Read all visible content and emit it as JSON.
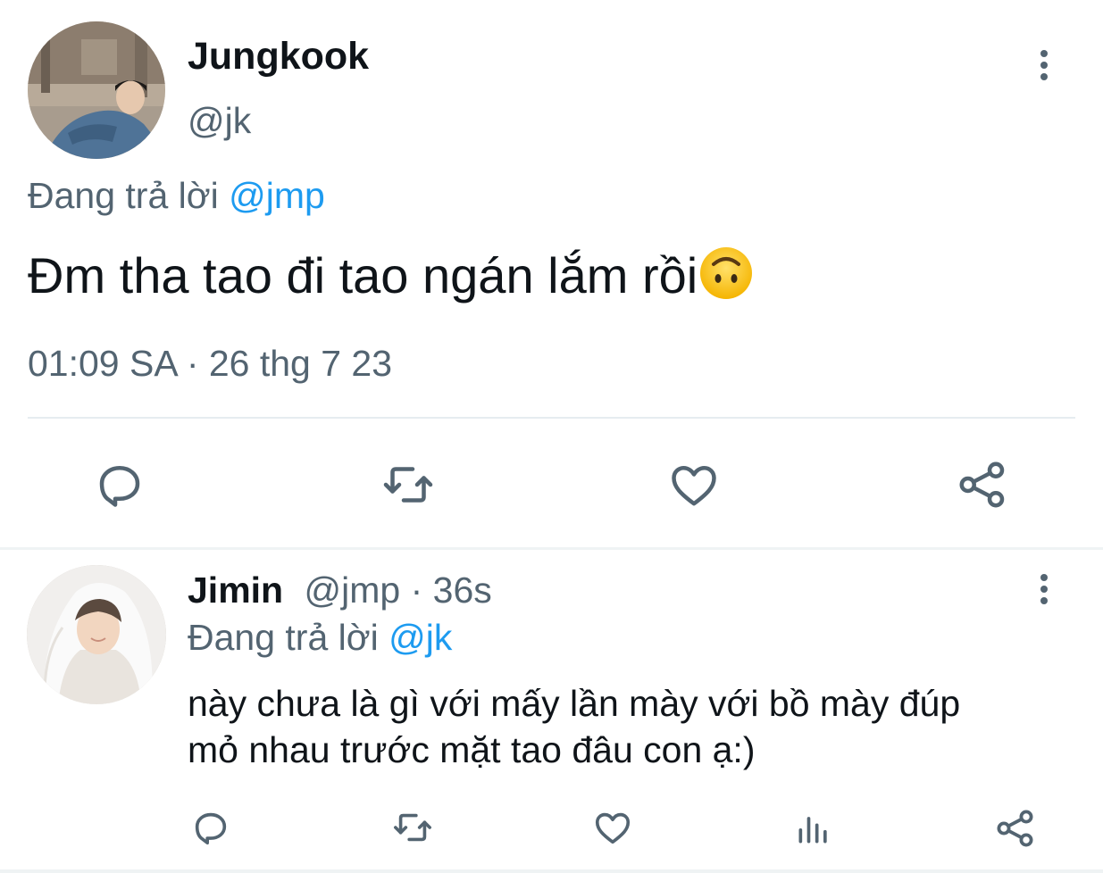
{
  "main_tweet": {
    "display_name": "Jungkook",
    "handle": "@jk",
    "replying_prefix": "Đang trả lời",
    "replying_to": "@jmp",
    "text": "Đm tha tao đi tao ngán lắm rồi",
    "emoji": "upside-down-face",
    "timestamp": "01:09 SA · 26 thg 7 23",
    "actions": [
      "reply-icon",
      "retweet-icon",
      "like-icon",
      "share-icon"
    ]
  },
  "reply_tweet": {
    "display_name": "Jimin",
    "handle": "@jmp",
    "age": "· 36s",
    "replying_prefix": "Đang trả lời",
    "replying_to": "@jk",
    "text_line1": "này chưa là gì với mấy lần mày với bồ mày đúp",
    "text_line2": "mỏ nhau trước mặt tao đâu con ạ:)",
    "actions": [
      "reply-icon",
      "retweet-icon",
      "like-icon",
      "views-icon",
      "share-icon"
    ]
  },
  "colors": {
    "text": "#0f1419",
    "muted": "#536471",
    "link": "#1d9bf0",
    "divider": "#e6ecf0"
  }
}
